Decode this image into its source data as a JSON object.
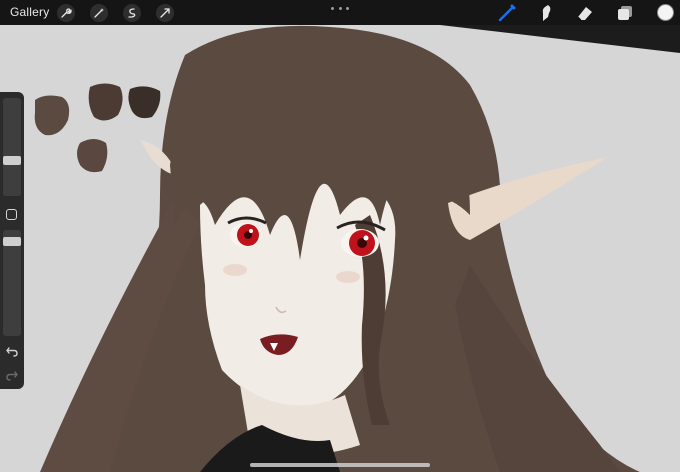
{
  "toolbar": {
    "gallery_label": "Gallery",
    "left_tools": [
      "wrench-icon",
      "magic-wand-icon",
      "selection-icon",
      "transform-icon"
    ],
    "right_tools": [
      "brush-icon",
      "smudge-icon",
      "eraser-icon",
      "layers-icon"
    ],
    "active_tool": "brush-icon",
    "active_color": "#1e6fe8",
    "current_color": "#f4f4f4"
  },
  "sidebar": {
    "brush_size_level": 0.35,
    "opacity_level": 0.93,
    "buttons": [
      "modify-button",
      "undo-button",
      "redo-button"
    ]
  },
  "canvas": {
    "palette_swatches": [
      "#5b4a40",
      "#4b3b33",
      "#3a2e29",
      "#5a4840"
    ],
    "colors": {
      "background": "#d6d6d6",
      "hair": "#5b4a40",
      "skin": "#f1ece6",
      "eye": "#c0121a",
      "lip": "#7a1d22"
    }
  }
}
